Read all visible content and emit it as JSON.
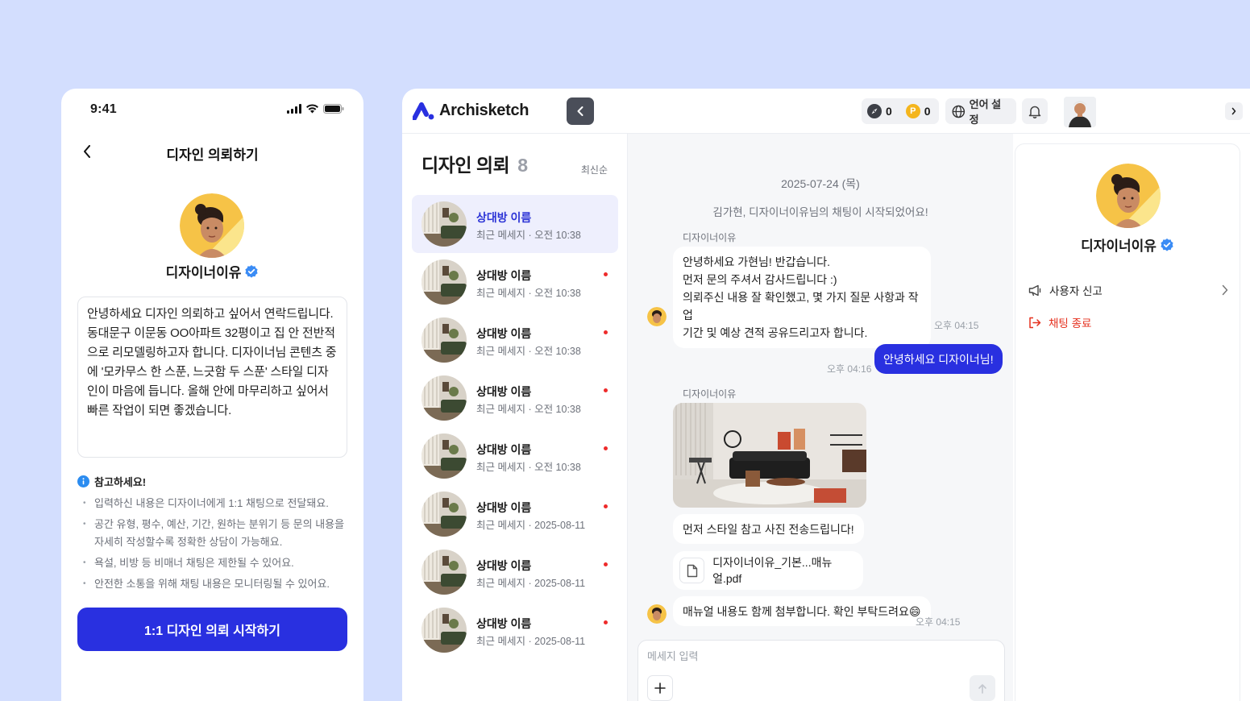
{
  "mobile": {
    "status_time": "9:41",
    "header_title": "디자인 의뢰하기",
    "designer_name": "디자이너이유",
    "request_text": "안녕하세요 디자인 의뢰하고 싶어서 연락드립니다. 동대문구 이문동 OO아파트 32평이고 집 안 전반적으로 리모델링하고자 합니다. 디자이너님 콘텐츠 중에 '모카무스 한 스푼, 느긋함 두 스푼' 스타일 디자인이 마음에 듭니다. 올해 안에 마무리하고 싶어서 빠른 작업이 되면 좋겠습니다.",
    "notice_title": "참고하세요!",
    "notice_items": [
      "입력하신 내용은 디자이너에게 1:1 채팅으로 전달돼요.",
      "공간 유형, 평수, 예산, 기간, 원하는 분위기 등 문의 내용을 자세히 작성할수록 정확한 상담이 가능해요.",
      "욕설, 비방 등 비매너 채팅은 제한될 수 있어요.",
      "안전한 소통을 위해 채팅 내용은 모니터링될 수 있어요."
    ],
    "cta_label": "1:1 디자인 의뢰 시작하기"
  },
  "topbar": {
    "logo_text": "Archisketch",
    "points_a": "0",
    "points_b": "0",
    "coin_p_letter": "P",
    "lang_label": "언어 설정"
  },
  "list": {
    "title": "디자인 의뢰",
    "count": "8",
    "sort_label": "최신순",
    "rooms": [
      {
        "name": "상대방 이름",
        "preview": "최근 메세지 · 오전 10:38",
        "active": true,
        "unread": false
      },
      {
        "name": "상대방 이름",
        "preview": "최근 메세지 · 오전 10:38",
        "active": false,
        "unread": true
      },
      {
        "name": "상대방 이름",
        "preview": "최근 메세지 · 오전 10:38",
        "active": false,
        "unread": true
      },
      {
        "name": "상대방 이름",
        "preview": "최근 메세지 · 오전 10:38",
        "active": false,
        "unread": true
      },
      {
        "name": "상대방 이름",
        "preview": "최근 메세지 · 오전 10:38",
        "active": false,
        "unread": true
      },
      {
        "name": "상대방 이름",
        "preview": "최근 메세지 · 2025-08-11",
        "active": false,
        "unread": true
      },
      {
        "name": "상대방 이름",
        "preview": "최근 메세지 · 2025-08-11",
        "active": false,
        "unread": true
      },
      {
        "name": "상대방 이름",
        "preview": "최근 메세지 · 2025-08-11",
        "active": false,
        "unread": true
      }
    ]
  },
  "chat": {
    "date": "2025-07-24 (목)",
    "system_message": "김가현, 디자이너이유님의 채팅이 시작되었어요!",
    "sender_name": "디자이너이유",
    "msg1_lines": [
      "안녕하세요 가현님! 반갑습니다.",
      "먼저 문의 주셔서 감사드립니다 :)",
      "의뢰주신 내용 잘 확인했고, 몇 가지 질문 사항과 작업",
      "기간 및 예상 견적 공유드리고자 합니다."
    ],
    "msg1_time": "오후 04:15",
    "msg2": "안녕하세요 디자이너님!",
    "msg2_time": "오후 04:16",
    "sender_name_2": "디자이너이유",
    "msg3": "먼저 스타일 참고 사진 전송드립니다!",
    "file_name": "디자이너이유_기본...매뉴얼.pdf",
    "msg4": "매뉴얼 내용도 함께 첨부합니다. 확인 부탁드려요😄",
    "msg4_time": "오후 04:15",
    "input_placeholder": "메세지 입력"
  },
  "profile": {
    "name": "디자이너이유",
    "report_label": "사용자 신고",
    "end_label": "채팅 종료"
  },
  "colors": {
    "background": "#d3defe",
    "primary": "#2930e0",
    "danger": "#e5301e",
    "unread_dot": "#ee2b2b",
    "verified": "#3b8cf5"
  }
}
